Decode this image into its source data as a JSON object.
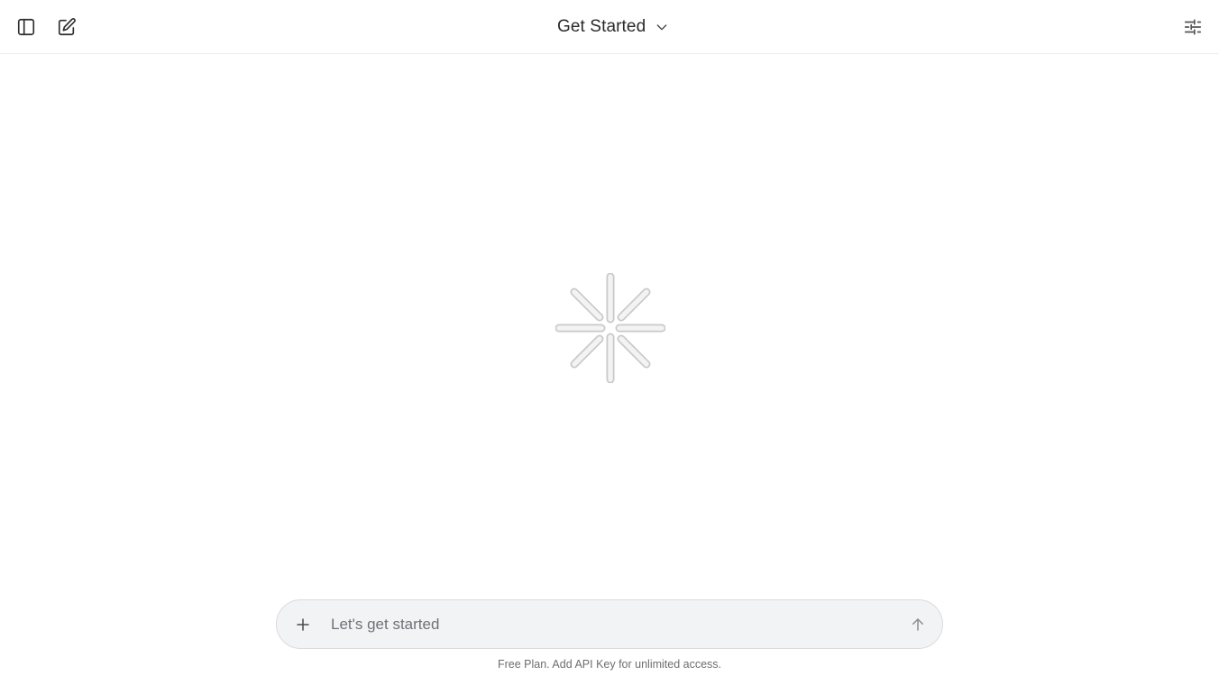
{
  "header": {
    "title": "Get Started",
    "icons": {
      "sidebar_toggle": "sidebar-panel-icon",
      "new_chat": "edit-square-icon",
      "title_chevron": "chevron-down-icon",
      "settings": "sliders-icon"
    }
  },
  "main": {
    "loading_indicator": "spinner-icon"
  },
  "composer": {
    "placeholder": "Let's get started",
    "value": "",
    "add_icon": "plus-icon",
    "send_icon": "arrow-up-icon"
  },
  "footer": {
    "note": "Free Plan. Add API Key for unlimited access."
  },
  "colors": {
    "background": "#ffffff",
    "header_border": "#ececec",
    "composer_bg": "#f2f3f5",
    "composer_border": "#d9dbdf",
    "icon": "#3a3a3a",
    "muted_text": "#6e6e6e"
  }
}
